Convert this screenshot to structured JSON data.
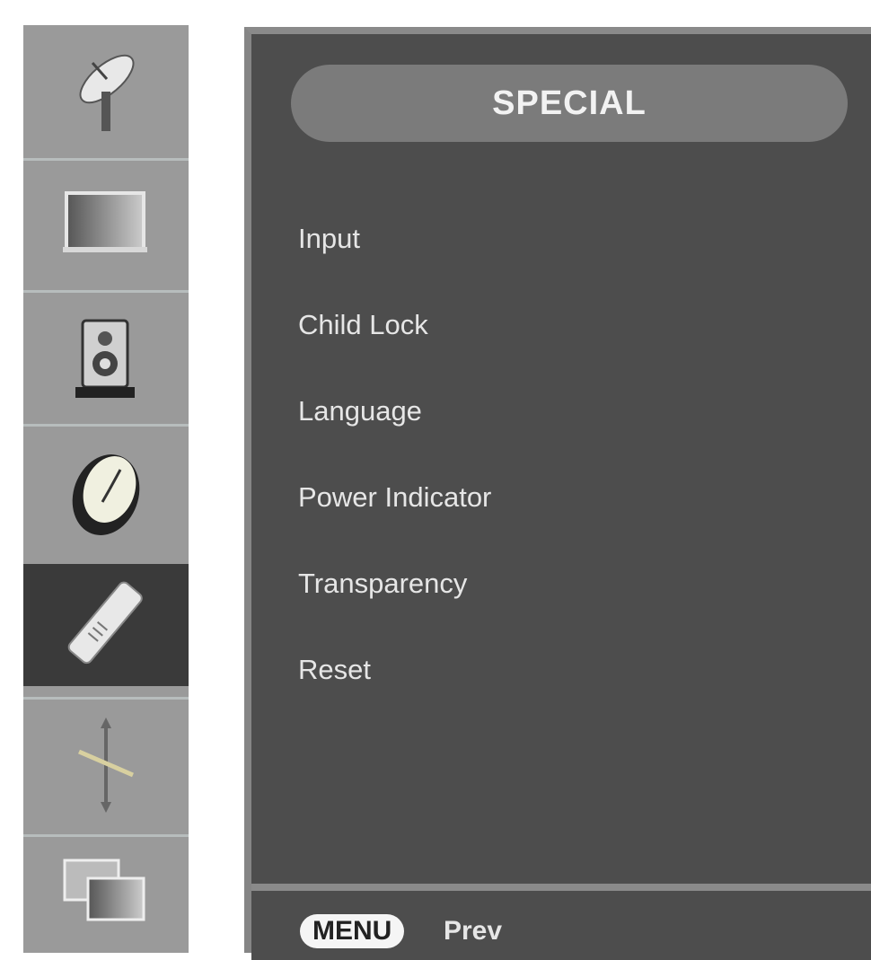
{
  "sidebar": {
    "items": [
      {
        "icon": "satellite-dish-icon",
        "active": false
      },
      {
        "icon": "picture-screen-icon",
        "active": false
      },
      {
        "icon": "speaker-icon",
        "active": false
      },
      {
        "icon": "clock-icon",
        "active": false
      },
      {
        "icon": "remote-control-icon",
        "active": true
      },
      {
        "icon": "adjust-arrows-icon",
        "active": false
      },
      {
        "icon": "screen-window-icon",
        "active": false
      }
    ]
  },
  "panel": {
    "title": "SPECIAL",
    "menu": [
      "Input",
      "Child Lock",
      "Language",
      "Power Indicator",
      "Transparency",
      "Reset"
    ]
  },
  "footer": {
    "key_label": "MENU",
    "action_label": "Prev"
  },
  "colors": {
    "panel_bg": "#4d4d4d",
    "sidebar_bg": "#9a9a9a",
    "active_item_bg": "#3a3a3a",
    "title_bar_bg": "#7b7b7b"
  }
}
